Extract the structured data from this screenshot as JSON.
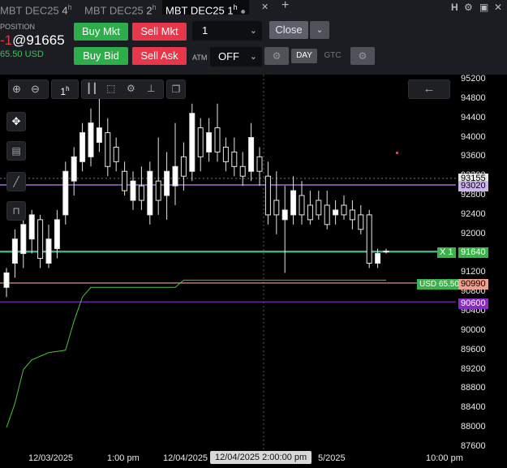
{
  "tabs": [
    {
      "label": "MBT DEC25",
      "tf": "4",
      "tf_sup": "h",
      "active": false
    },
    {
      "label": "MBT DEC25",
      "tf": "2",
      "tf_sup": "h",
      "active": false
    },
    {
      "label": "MBT DEC25",
      "tf": "1",
      "tf_sup": "h",
      "active": true
    }
  ],
  "tab_add": "+",
  "tab_right_icons": [
    "H",
    "gear-icon",
    "window-icon",
    "close-icon"
  ],
  "position": {
    "label": "POSITION",
    "qty": "-1",
    "price": "@91665",
    "pnl": "65.50 USD",
    "pnl_color": "#34c759",
    "qty_color": "#e8364a"
  },
  "buttons": {
    "buy_mkt": "Buy Mkt",
    "sell_mkt": "Sell Mkt",
    "buy_bid": "Buy Bid",
    "sell_ask": "Sell Ask",
    "close": "Close",
    "atm_label": "ATM",
    "atm_value": "OFF",
    "day": "DAY",
    "gtc": "GTC"
  },
  "quantity": "1",
  "chart_toolbar": {
    "timeframe": "1",
    "timeframe_sup": "h"
  },
  "y_axis": [
    "95200",
    "94800",
    "94400",
    "94000",
    "93600",
    "93200",
    "92800",
    "92400",
    "92000",
    "91600",
    "91200",
    "90800",
    "90400",
    "90000",
    "89600",
    "89200",
    "88800",
    "88400",
    "88000",
    "87600"
  ],
  "x_axis": [
    "12/03/2025",
    "1:00 pm",
    "12/04/2025",
    "2:00:00 pm",
    "5/2025",
    "10:00 pm"
  ],
  "crosshair_label": "12/04/2025 2:00:00 pm",
  "price_tags": {
    "current": "93155",
    "violet_line": "93020",
    "position": "91640",
    "position_prefix": "X 1",
    "target": "90990",
    "target_prefix": "USD 65.50",
    "stop": "90600"
  },
  "colors": {
    "green": "#2eae4a",
    "red": "#e8364a",
    "violet": "#a26bd6",
    "target": "#f0a08c",
    "stop": "#8a2bc6",
    "position_line": "#3fae7a"
  },
  "chart_data": {
    "type": "candlestick",
    "y_range": [
      87600,
      95200
    ],
    "candles": [
      [
        90700,
        91300,
        90900,
        91200
      ],
      [
        91100,
        92100,
        91400,
        91900
      ],
      [
        91300,
        92300,
        91600,
        92200
      ],
      [
        91600,
        92500,
        91900,
        92400
      ],
      [
        91300,
        92400,
        92300,
        91500
      ],
      [
        91300,
        92200,
        91400,
        91900
      ],
      [
        91500,
        92500,
        91700,
        92300
      ],
      [
        92200,
        93500,
        92400,
        93300
      ],
      [
        92800,
        93800,
        93100,
        93600
      ],
      [
        93300,
        94300,
        93500,
        94100
      ],
      [
        93400,
        94600,
        93600,
        94300
      ],
      [
        93700,
        94900,
        93900,
        94200
      ],
      [
        93200,
        94400,
        94100,
        93400
      ],
      [
        93300,
        94000,
        93800,
        93500
      ],
      [
        92800,
        93500,
        93300,
        92900
      ],
      [
        92500,
        93300,
        92700,
        93100
      ],
      [
        92500,
        93400,
        93000,
        92700
      ],
      [
        92200,
        93500,
        92400,
        93300
      ],
      [
        92400,
        94000,
        93100,
        92700
      ],
      [
        92300,
        93700,
        92800,
        93300
      ],
      [
        92600,
        94300,
        93000,
        93400
      ],
      [
        92900,
        93900,
        93600,
        93200
      ],
      [
        93100,
        94700,
        93300,
        94500
      ],
      [
        93300,
        94400,
        94200,
        93600
      ],
      [
        93500,
        94400,
        93700,
        94100
      ],
      [
        93500,
        94700,
        94200,
        93700
      ],
      [
        93300,
        94000,
        93800,
        93500
      ],
      [
        93200,
        94000,
        93700,
        93400
      ],
      [
        93000,
        93700,
        93400,
        93200
      ],
      [
        93100,
        94300,
        93300,
        94000
      ],
      [
        93000,
        93800,
        93600,
        93300
      ],
      [
        92200,
        93500,
        93200,
        92400
      ],
      [
        92000,
        93300,
        92700,
        92400
      ],
      [
        91200,
        93000,
        92300,
        92500
      ],
      [
        92200,
        93200,
        92400,
        92900
      ],
      [
        92200,
        93100,
        92800,
        92400
      ],
      [
        92200,
        92900,
        92600,
        92300
      ],
      [
        92300,
        92900,
        92700,
        92400
      ],
      [
        92100,
        92900,
        92600,
        92200
      ],
      [
        92200,
        92700,
        92400,
        92500
      ],
      [
        92300,
        92800,
        92600,
        92400
      ],
      [
        92100,
        92700,
        92500,
        92300
      ],
      [
        92000,
        92600,
        92400,
        92100
      ],
      [
        91300,
        92500,
        92400,
        91400
      ],
      [
        91300,
        91700,
        91400,
        91600
      ],
      [
        91600,
        91700,
        91650,
        91640
      ]
    ]
  }
}
